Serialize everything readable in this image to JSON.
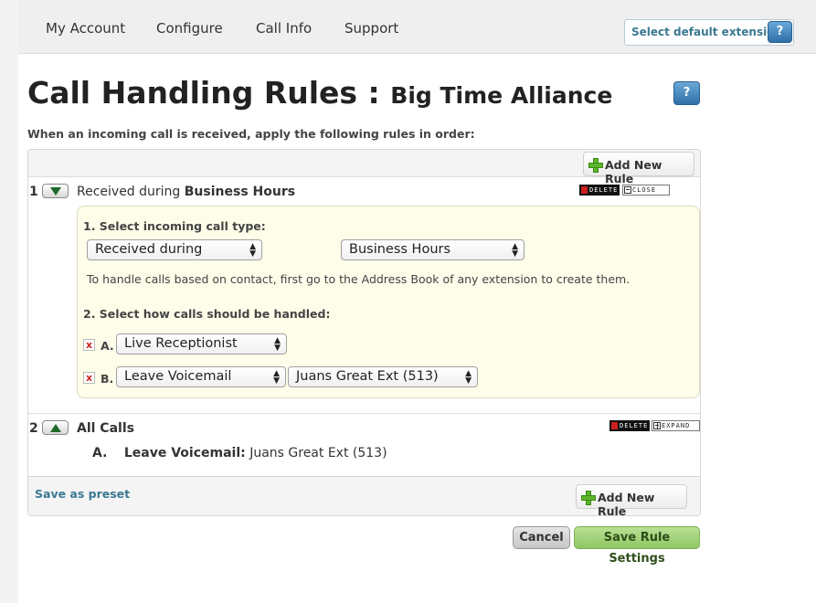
{
  "nav": {
    "items": [
      "My Account",
      "Configure",
      "Call Info",
      "Support"
    ],
    "select_extension": "Select default extension",
    "help": "?"
  },
  "page": {
    "title": "Call Handling Rules :",
    "subtitle": "Big Time Alliance",
    "help": "?",
    "intro": "When an incoming call is received, apply the following rules in order:"
  },
  "toolbar": {
    "add_rule": "Add New Rule"
  },
  "rules": [
    {
      "number": "1",
      "title_prefix": "Received during",
      "title_strong": "Business Hours",
      "delete": "DELETE",
      "close": "CLOSE",
      "editor": {
        "step1_label": "1. Select incoming call type:",
        "call_type": "Received during",
        "schedule": "Business Hours",
        "hint": "To handle calls based on contact, first go to the Address Book of any extension to create them.",
        "step2_label": "2. Select how calls should be handled:",
        "actions": [
          {
            "letter": "A.",
            "remove": "x",
            "action": "Live Receptionist"
          },
          {
            "letter": "B.",
            "remove": "x",
            "action": "Leave Voicemail",
            "target": "Juans Great Ext (513)"
          }
        ]
      }
    },
    {
      "number": "2",
      "title": "All Calls",
      "delete": "DELETE",
      "expand": "EXPAND",
      "summary": {
        "letter": "A.",
        "action": "Leave Voicemail:",
        "target": "Juans Great Ext (513)"
      }
    }
  ],
  "footer": {
    "save_preset": "Save as preset",
    "add_rule": "Add New Rule",
    "cancel": "Cancel",
    "save": "Save Rule Settings"
  },
  "colors": {
    "link": "#3b7891",
    "accent_green": "#8fc663",
    "help_blue": "#2e6fa8"
  }
}
